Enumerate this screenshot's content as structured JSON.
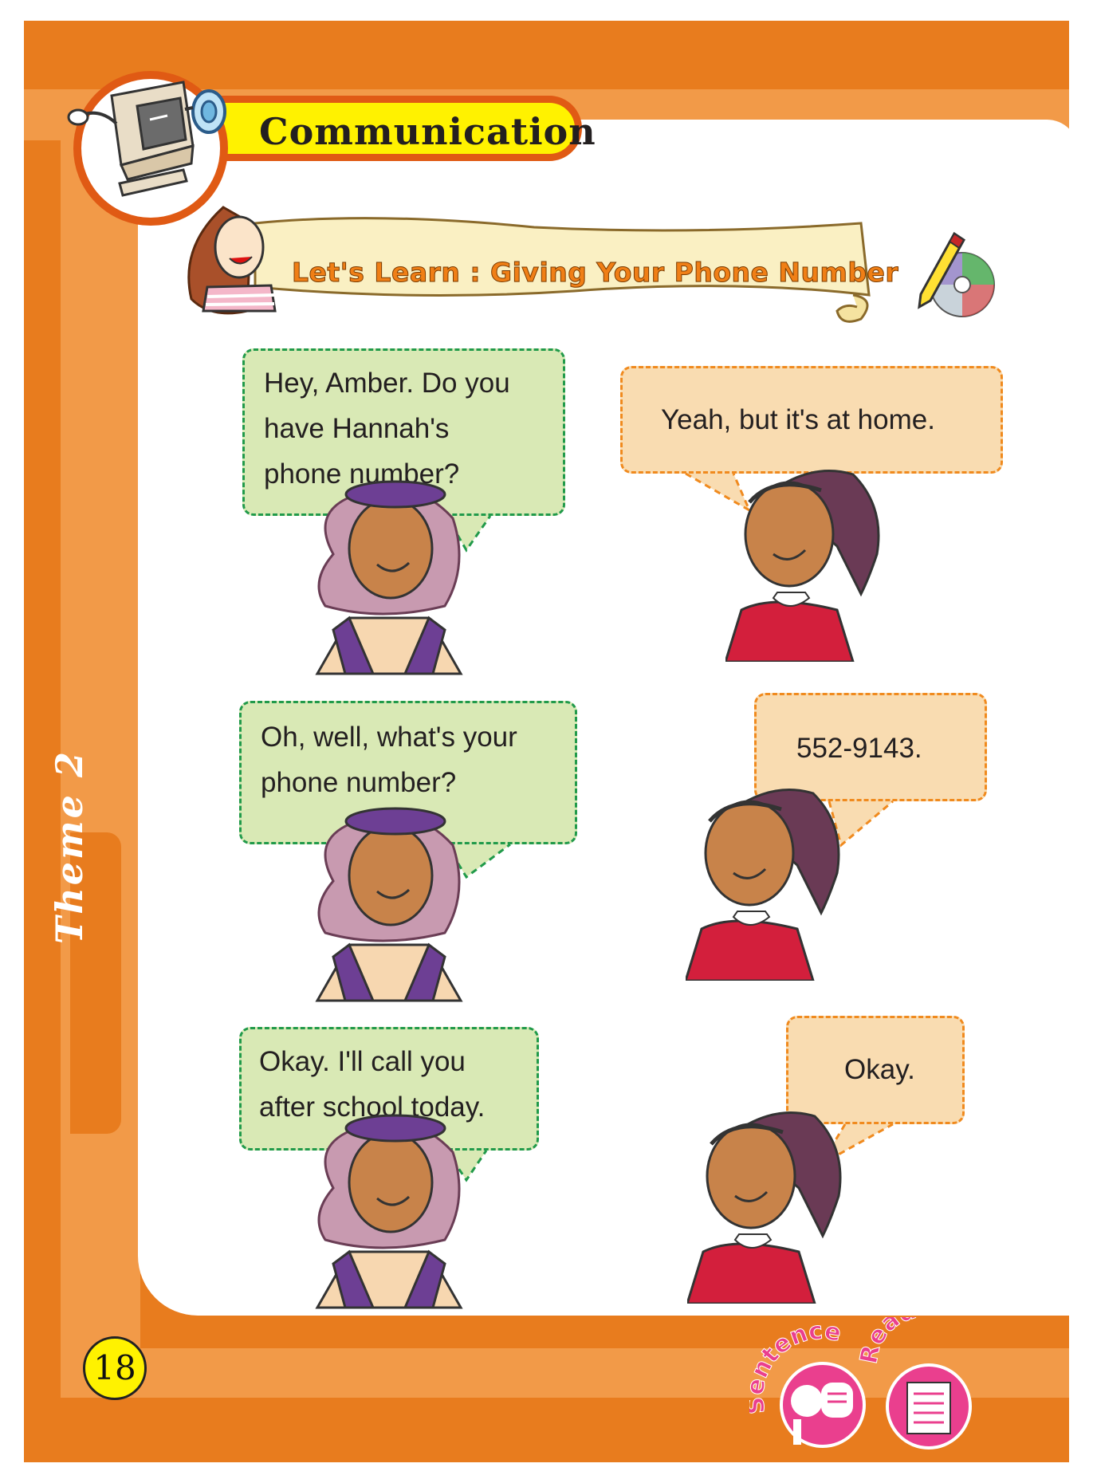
{
  "header": {
    "title": "Communication"
  },
  "lesson": {
    "title": "Let's Learn : Giving Your Phone Number"
  },
  "dialogue": [
    {
      "speaker": "girl-beret",
      "lines": [
        "Hey, Amber. Do you",
        "have Hannah's",
        "phone number?"
      ]
    },
    {
      "speaker": "girl-ponytail",
      "lines": [
        "Yeah, but it's at home."
      ]
    },
    {
      "speaker": "girl-beret",
      "lines": [
        "Oh, well, what's your",
        "phone number?"
      ]
    },
    {
      "speaker": "girl-ponytail",
      "lines": [
        "552-9143."
      ]
    },
    {
      "speaker": "girl-beret",
      "lines": [
        "Okay. I'll call you",
        "after school today."
      ]
    },
    {
      "speaker": "girl-ponytail",
      "lines": [
        "Okay."
      ]
    }
  ],
  "side_tab": {
    "label": "Theme 2"
  },
  "footer": {
    "page_number": "18",
    "buttons": [
      {
        "label": "Sentence",
        "icon": "speech-icon"
      },
      {
        "label": "Read",
        "icon": "document-icon"
      }
    ]
  },
  "colors": {
    "frame": "#e87c1e",
    "frame_light": "#f29a48",
    "green_bubble": "#d9e9b5",
    "green_border": "#219a4a",
    "orange_bubble": "#f9dcb1",
    "orange_border": "#f08a1e",
    "title_yellow": "#fff200",
    "pink_button": "#ea3f8e"
  }
}
